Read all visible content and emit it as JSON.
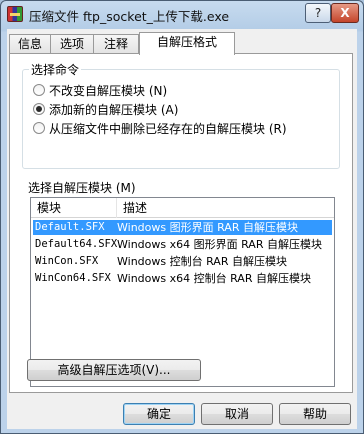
{
  "window": {
    "title": "压缩文件 ftp_socket_上传下载.exe",
    "help_label": "?",
    "close_label": "X"
  },
  "tabs": [
    {
      "label": "信息",
      "active": false
    },
    {
      "label": "选项",
      "active": false
    },
    {
      "label": "注释",
      "active": false
    },
    {
      "label": "自解压格式",
      "active": true
    }
  ],
  "command_group": {
    "title": "选择命令",
    "options": [
      {
        "label": "不改变自解压模块 (N)",
        "checked": false
      },
      {
        "label": "添加新的自解压模块 (A)",
        "checked": true
      },
      {
        "label": "从压缩文件中删除已经存在的自解压模块 (R)",
        "checked": false
      }
    ]
  },
  "module_list": {
    "label": "选择自解压模块 (M)",
    "columns": [
      "模块",
      "描述"
    ],
    "rows": [
      {
        "module": "Default.SFX",
        "desc": "Windows 图形界面 RAR 自解压模块",
        "selected": true
      },
      {
        "module": "Default64.SFX",
        "desc": "Windows x64 图形界面 RAR 自解压模块",
        "selected": false
      },
      {
        "module": "WinCon.SFX",
        "desc": "Windows 控制台 RAR 自解压模块",
        "selected": false
      },
      {
        "module": "WinCon64.SFX",
        "desc": "Windows x64 控制台 RAR 自解压模块",
        "selected": false
      }
    ]
  },
  "advanced_button": {
    "label": "高级自解压选项(V)..."
  },
  "footer": {
    "ok_label": "确定",
    "cancel_label": "取消",
    "help_label": "帮助"
  }
}
